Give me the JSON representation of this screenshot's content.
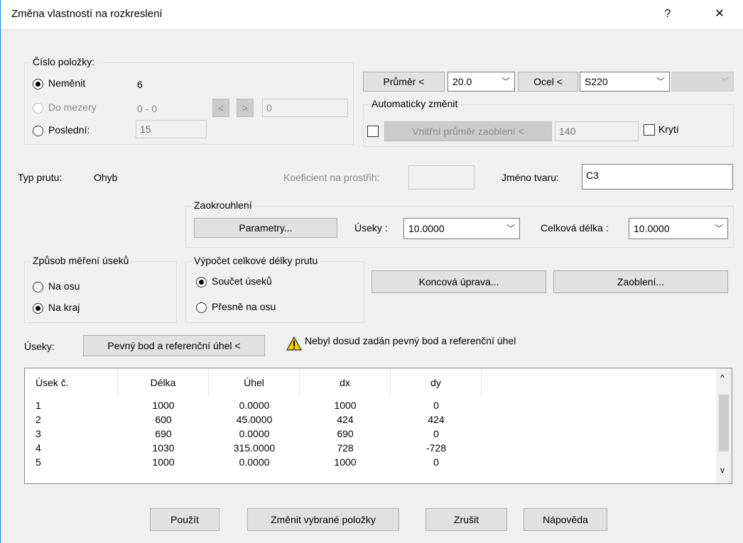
{
  "window": {
    "title": "Změna vlastností na rozkreslení",
    "help": "?",
    "close": "✕"
  },
  "item_group": {
    "legend": "Číslo položky:",
    "no_change_label": "Neměnit",
    "no_change_value": "6",
    "to_gap_label": "Do mezery",
    "to_gap_value": "0 - 0",
    "prev": "<",
    "next": ">",
    "gap_field": "0",
    "last_label": "Poslední:",
    "last_value": "15"
  },
  "top_controls": {
    "diameter_button": "Průměr <",
    "diameter_value": "20.0",
    "steel_button": "Ocel <",
    "steel_value": "S220"
  },
  "auto_group": {
    "legend": "Automaticky změnit",
    "bend_button": "Vnitřní průměr zaoblení <",
    "bend_value": "140",
    "cover_label": "Krytí"
  },
  "bar_type": {
    "label": "Typ prutu:",
    "value": "Ohyb"
  },
  "coef": {
    "label": "Koeficient na prostřih:",
    "value": ""
  },
  "shape_name": {
    "label": "Jméno tvaru:",
    "value": "C3"
  },
  "rounding": {
    "legend": "Zaokrouhlení",
    "params_button": "Parametry...",
    "segments_label": "Úseky :",
    "segments_value": "10.0000",
    "total_label": "Celková délka :",
    "total_value": "10.0000"
  },
  "measure_group": {
    "legend": "Způsob měření úseků",
    "axis": "Na osu",
    "edge": "Na kraj"
  },
  "calc_group": {
    "legend": "Výpočet celkové délky prutu",
    "sum": "Součet úseků",
    "exact": "Přesně na osu"
  },
  "end_button": "Koncová úprava...",
  "rounding_button": "Zaoblení...",
  "segments_row": {
    "label": "Úseky:",
    "ref_button": "Pevný bod a referenční úhel <",
    "warning": "Nebyl dosud zadán pevný bod a referenční úhel"
  },
  "table": {
    "headers": [
      "Úsek č.",
      "Délka",
      "Úhel",
      "dx",
      "dy"
    ],
    "rows": [
      [
        "1",
        "1000",
        "0.0000",
        "1000",
        "0"
      ],
      [
        "2",
        "600",
        "45.0000",
        "424",
        "424"
      ],
      [
        "3",
        "690",
        "0.0000",
        "690",
        "0"
      ],
      [
        "4",
        "1030",
        "315.0000",
        "728",
        "-728"
      ],
      [
        "5",
        "1000",
        "0.0000",
        "1000",
        "0"
      ]
    ],
    "scroll_up": "^",
    "scroll_down": "v"
  },
  "footer": {
    "apply": "Použít",
    "change_selected": "Změnit vybrané položky",
    "cancel": "Zrušit",
    "help": "Nápověda"
  },
  "colors": {
    "window_bg": "#f0f0f0",
    "accent_border": "#1b7fd1",
    "warning": "#f2d000"
  },
  "icons": [
    "radio-icon",
    "checkbox-icon",
    "warning-icon",
    "chevron-down-icon",
    "close-icon",
    "help-icon"
  ]
}
